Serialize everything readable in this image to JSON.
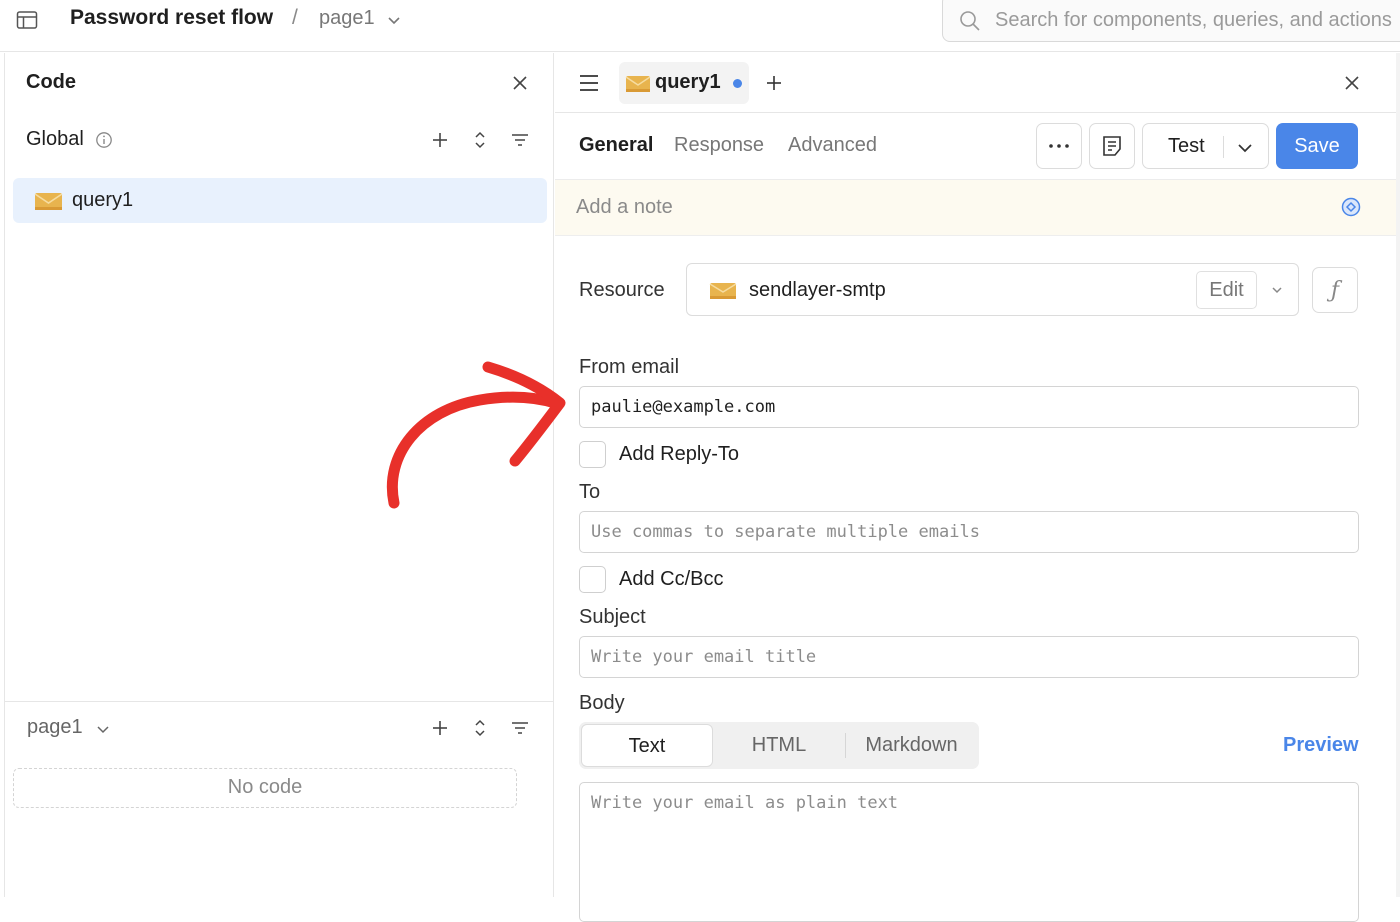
{
  "header": {
    "app_title": "Password reset flow",
    "separator": "/",
    "page_name": "page1",
    "search_placeholder": "Search for components, queries, and actions"
  },
  "left_panel": {
    "title": "Code",
    "global_label": "Global",
    "queries": [
      {
        "label": "query1",
        "icon": "mail-icon"
      }
    ],
    "page_section": {
      "label": "page1",
      "empty_text": "No code"
    }
  },
  "editor": {
    "tab": {
      "label": "query1",
      "unsaved": true
    },
    "subtabs": [
      "General",
      "Response",
      "Advanced"
    ],
    "active_subtab": "General",
    "test_label": "Test",
    "save_label": "Save",
    "note_placeholder": "Add a note",
    "resource": {
      "label": "Resource",
      "value": "sendlayer-smtp",
      "edit_label": "Edit"
    },
    "from_email": {
      "label": "From email",
      "value": "paulie@example.com"
    },
    "reply_to": {
      "label": "Add Reply-To",
      "checked": false
    },
    "to": {
      "label": "To",
      "placeholder": "Use commas to separate multiple emails"
    },
    "cc_bcc": {
      "label": "Add Cc/Bcc",
      "checked": false
    },
    "subject": {
      "label": "Subject",
      "placeholder": "Write your email title"
    },
    "body": {
      "label": "Body",
      "formats": [
        "Text",
        "HTML",
        "Markdown"
      ],
      "active_format": "Text",
      "preview_label": "Preview",
      "placeholder": "Write your email as plain text"
    }
  },
  "colors": {
    "accent": "#4a86e8",
    "selected_bg": "#e8f1fd",
    "note_bg": "#fdfaf0",
    "annotation_arrow": "#e8302a"
  }
}
